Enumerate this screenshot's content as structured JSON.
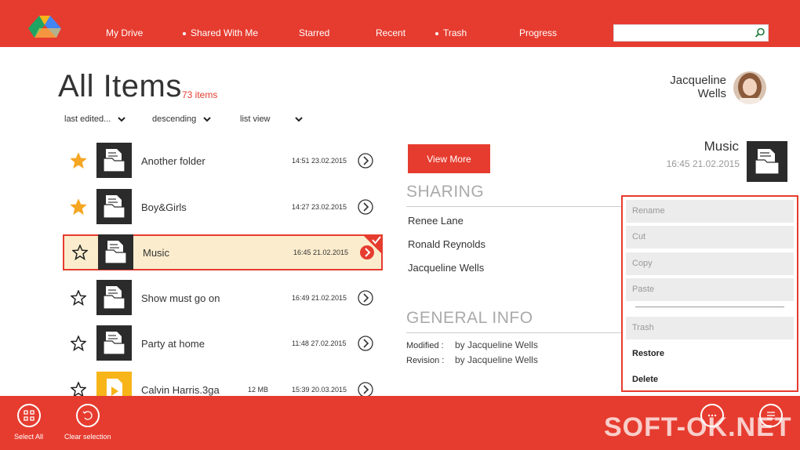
{
  "header": {
    "logo_icon": "google-drive-logo",
    "nav": [
      {
        "label": "My Drive"
      },
      {
        "label": "Shared With Me"
      },
      {
        "label": "Starred"
      },
      {
        "label": "Recent"
      },
      {
        "label": "Trash"
      },
      {
        "label": "Progress"
      }
    ],
    "search": {
      "placeholder": "",
      "value": "",
      "icon": "search-icon"
    }
  },
  "page": {
    "title": "All Items",
    "count": "73 items"
  },
  "user": {
    "first_name": "Jacqueline",
    "last_name": "Wells",
    "avatar_icon": "user-avatar"
  },
  "sort": {
    "field": "last edited...",
    "order": "descending",
    "view": "list view"
  },
  "files": [
    {
      "name": "Another folder",
      "size": "",
      "date": "14:51 23.02.2015",
      "starred": true,
      "type": "folder",
      "selected": false
    },
    {
      "name": "Boy&Girls",
      "size": "",
      "date": "14:27 23.02.2015",
      "starred": true,
      "type": "folder",
      "selected": false
    },
    {
      "name": "Music",
      "size": "",
      "date": "16:45 21.02.2015",
      "starred": false,
      "type": "folder",
      "selected": true
    },
    {
      "name": "Show must go on",
      "size": "",
      "date": "16:49 21.02.2015",
      "starred": false,
      "type": "folder",
      "selected": false
    },
    {
      "name": "Party at home",
      "size": "",
      "date": "11:48 27.02.2015",
      "starred": false,
      "type": "folder",
      "selected": false
    },
    {
      "name": "Calvin Harris.3ga",
      "size": "12 MB",
      "date": "15:39 20.03.2015",
      "starred": false,
      "type": "audio",
      "selected": false
    }
  ],
  "detail": {
    "view_more": "View More",
    "title": "Music",
    "date": "16:45 21.02.2015",
    "sharing_title": "SHARING",
    "sharing": [
      "Renee Lane",
      "Ronald Reynolds",
      "Jacqueline Wells"
    ],
    "general_title": "GENERAL INFO",
    "modified_label": "Modified :",
    "modified_by": "by  Jacqueline Wells",
    "revision_label": "Revision :",
    "revision_by": "by  Jacqueline Wells"
  },
  "context_menu": {
    "items": [
      {
        "label": "Rename",
        "enabled": false
      },
      {
        "label": "Cut",
        "enabled": false
      },
      {
        "label": "Copy",
        "enabled": false
      },
      {
        "label": "Paste",
        "enabled": false
      },
      {
        "label": "Trash",
        "enabled": false
      },
      {
        "label": "Restore",
        "enabled": true
      },
      {
        "label": "Delete",
        "enabled": true
      }
    ]
  },
  "bottom": {
    "select_all": "Select All",
    "clear_selection": "Clear selection",
    "watermark": "SOFT-OK.NET"
  },
  "colors": {
    "accent": "#e63c2f",
    "selected_row": "#fbeccd",
    "star_filled": "#f5a623",
    "tile_dark": "#2b2b2b",
    "tile_audio": "#f7b51a"
  }
}
